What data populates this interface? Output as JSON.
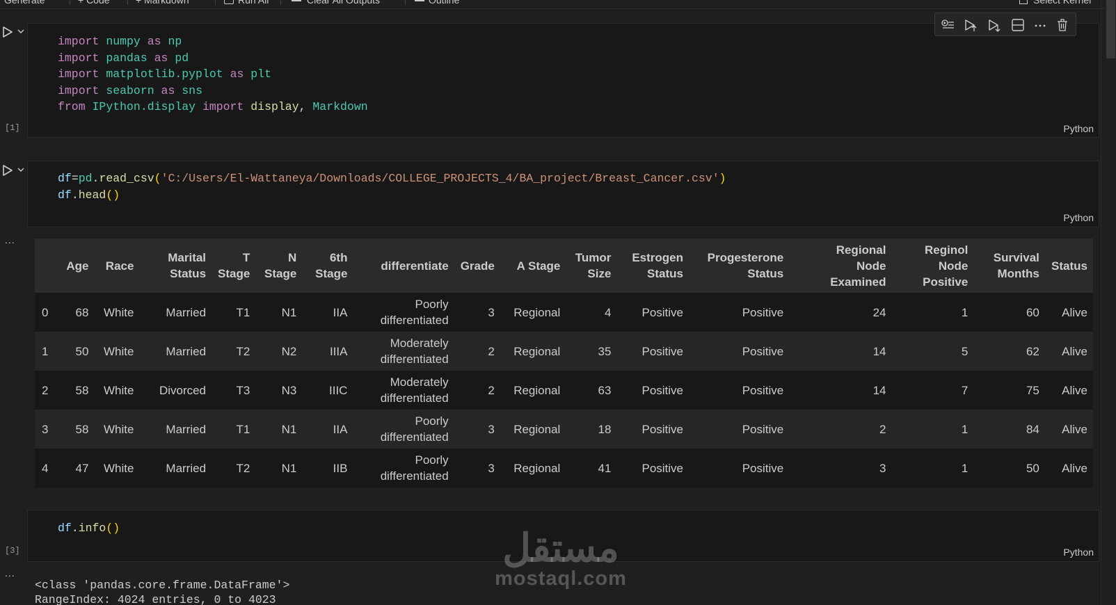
{
  "toolbar": {
    "generate": "Generate",
    "code": "+ Code",
    "markdown": "+ Markdown",
    "run_all": "Run All",
    "clear_all_outputs": "Clear All Outputs",
    "outline": "Outline",
    "select_kernel": "Select Kernel"
  },
  "cells": [
    {
      "exec_count": "[1]",
      "language": "Python",
      "lines": [
        [
          [
            "import",
            "kw"
          ],
          [
            " ",
            "plain"
          ],
          [
            "numpy",
            "mod"
          ],
          [
            " ",
            "plain"
          ],
          [
            "as",
            "kw"
          ],
          [
            " ",
            "plain"
          ],
          [
            "np",
            "mod"
          ]
        ],
        [
          [
            "import",
            "kw"
          ],
          [
            " ",
            "plain"
          ],
          [
            "pandas",
            "mod"
          ],
          [
            " ",
            "plain"
          ],
          [
            "as",
            "kw"
          ],
          [
            " ",
            "plain"
          ],
          [
            "pd",
            "mod"
          ]
        ],
        [
          [
            "import",
            "kw"
          ],
          [
            " ",
            "plain"
          ],
          [
            "matplotlib.pyplot",
            "mod"
          ],
          [
            " ",
            "plain"
          ],
          [
            "as",
            "kw"
          ],
          [
            " ",
            "plain"
          ],
          [
            "plt",
            "mod"
          ]
        ],
        [
          [
            "import",
            "kw"
          ],
          [
            " ",
            "plain"
          ],
          [
            "seaborn",
            "mod"
          ],
          [
            " ",
            "plain"
          ],
          [
            "as",
            "kw"
          ],
          [
            " ",
            "plain"
          ],
          [
            "sns",
            "mod"
          ]
        ],
        [
          [
            "from",
            "kw"
          ],
          [
            " ",
            "plain"
          ],
          [
            "IPython.display",
            "mod"
          ],
          [
            " ",
            "plain"
          ],
          [
            "import",
            "kw"
          ],
          [
            " ",
            "plain"
          ],
          [
            "display",
            "fn"
          ],
          [
            ", ",
            "plain"
          ],
          [
            "Markdown",
            "mod"
          ]
        ]
      ]
    },
    {
      "exec_count": "",
      "language": "Python",
      "lines": [
        [
          [
            "df",
            "id"
          ],
          [
            "=",
            "plain"
          ],
          [
            "pd",
            "mod"
          ],
          [
            ".",
            "plain"
          ],
          [
            "read_csv",
            "fn"
          ],
          [
            "(",
            "par"
          ],
          [
            "'C:/Users/El-Wattaneya/Downloads/COLLEGE_PROJECTS_4/BA_project/Breast_Cancer.csv'",
            "str"
          ],
          [
            ")",
            "par"
          ]
        ],
        [
          [
            "df",
            "id"
          ],
          [
            ".",
            "plain"
          ],
          [
            "head",
            "fn"
          ],
          [
            "()",
            "par"
          ]
        ]
      ]
    },
    {
      "exec_count": "[3]",
      "language": "Python",
      "lines": [
        [
          [
            "df",
            "id"
          ],
          [
            ".",
            "plain"
          ],
          [
            "info",
            "fn"
          ],
          [
            "()",
            "par"
          ]
        ]
      ]
    }
  ],
  "output_ellipsis": "...",
  "table": {
    "headers": [
      "",
      "Age",
      "Race",
      "Marital\nStatus",
      "T\nStage",
      "N\nStage",
      "6th\nStage",
      "differentiate",
      "Grade",
      "A Stage",
      "Tumor\nSize",
      "Estrogen\nStatus",
      "Progesterone\nStatus",
      "Regional\nNode\nExamined",
      "Reginol\nNode\nPositive",
      "Survival\nMonths",
      "Status"
    ],
    "rows": [
      [
        "0",
        "68",
        "White",
        "Married",
        "T1",
        "N1",
        "IIA",
        "Poorly\ndifferentiated",
        "3",
        "Regional",
        "4",
        "Positive",
        "Positive",
        "24",
        "1",
        "60",
        "Alive"
      ],
      [
        "1",
        "50",
        "White",
        "Married",
        "T2",
        "N2",
        "IIIA",
        "Moderately\ndifferentiated",
        "2",
        "Regional",
        "35",
        "Positive",
        "Positive",
        "14",
        "5",
        "62",
        "Alive"
      ],
      [
        "2",
        "58",
        "White",
        "Divorced",
        "T3",
        "N3",
        "IIIC",
        "Moderately\ndifferentiated",
        "2",
        "Regional",
        "63",
        "Positive",
        "Positive",
        "14",
        "7",
        "75",
        "Alive"
      ],
      [
        "3",
        "58",
        "White",
        "Married",
        "T1",
        "N1",
        "IIA",
        "Poorly\ndifferentiated",
        "3",
        "Regional",
        "18",
        "Positive",
        "Positive",
        "2",
        "1",
        "84",
        "Alive"
      ],
      [
        "4",
        "47",
        "White",
        "Married",
        "T2",
        "N1",
        "IIB",
        "Poorly\ndifferentiated",
        "3",
        "Regional",
        "41",
        "Positive",
        "Positive",
        "3",
        "1",
        "50",
        "Alive"
      ]
    ]
  },
  "info_output": {
    "line1": "<class 'pandas.core.frame.DataFrame'>",
    "line2": "RangeIndex: 4024 entries, 0 to 4023"
  },
  "watermark": {
    "arabic": "مستقل",
    "latin": "mostaql.com"
  },
  "icons": {
    "run": "play-icon",
    "expand": "chevron-down-icon",
    "cell_toolbar": [
      "run-by-line-icon",
      "execute-above-icon",
      "execute-below-icon",
      "split-cell-icon",
      "more-icon",
      "delete-icon"
    ]
  },
  "colors": {
    "background": "#1f1f1f",
    "cell_background": "#181818",
    "keyword": "#c586c0",
    "module": "#4ec9b0",
    "function": "#dcdcaa",
    "string": "#ce9178",
    "variable": "#9cdcfe"
  }
}
